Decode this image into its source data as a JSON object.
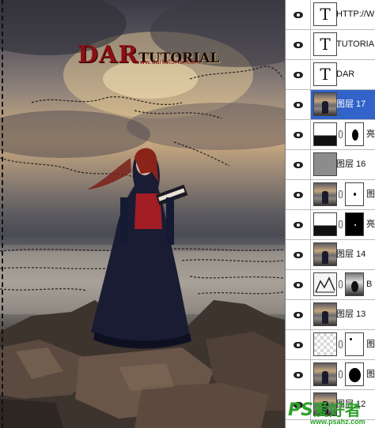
{
  "canvas": {
    "watermark": {
      "dar": "DAR",
      "tutorial": "TUTORIAL",
      "url": "www.dartutorial.com"
    }
  },
  "layers": [
    {
      "name": "HTTP://W",
      "thumb": "text",
      "thumb_label": "T",
      "mask": null,
      "selected": false
    },
    {
      "name": "TUTORIA",
      "thumb": "text",
      "thumb_label": "T",
      "mask": null,
      "selected": false
    },
    {
      "name": "DAR",
      "thumb": "text",
      "thumb_label": "T",
      "mask": null,
      "selected": false
    },
    {
      "name": "图层 17",
      "thumb": "photo",
      "thumb_label": "",
      "mask": null,
      "selected": true
    },
    {
      "name": "亮",
      "thumb": "adjust",
      "thumb_label": "",
      "mask": "white-blob",
      "selected": false
    },
    {
      "name": "图层 16",
      "thumb": "gray",
      "thumb_label": "",
      "mask": null,
      "selected": false
    },
    {
      "name": "图",
      "thumb": "photo",
      "thumb_label": "",
      "mask": "white-tiny",
      "selected": false
    },
    {
      "name": "亮",
      "thumb": "adjust",
      "thumb_label": "",
      "mask": "black-dot",
      "selected": false
    },
    {
      "name": "图层 14",
      "thumb": "photo",
      "thumb_label": "",
      "mask": null,
      "selected": false
    },
    {
      "name": "B",
      "thumb": "levels",
      "thumb_label": "",
      "mask": "photo-dark",
      "selected": false
    },
    {
      "name": "图层 13",
      "thumb": "photo",
      "thumb_label": "",
      "mask": null,
      "selected": false
    },
    {
      "name": "图",
      "thumb": "checker",
      "thumb_label": "",
      "mask": "white-speck",
      "selected": false
    },
    {
      "name": "图",
      "thumb": "photo",
      "thumb_label": "",
      "mask": "white-big-blob",
      "selected": false
    },
    {
      "name": "图层 12",
      "thumb": "photo",
      "thumb_label": "",
      "mask": null,
      "selected": false
    }
  ],
  "logo": {
    "ps": "PS",
    "brand": "爱好者",
    "url": "www.psahz.com"
  },
  "colors": {
    "selected_row": "#3163c8",
    "panel_bg": "#ffffff",
    "logo_green": "#2ea12a",
    "watermark_red": "#8a0f14"
  }
}
